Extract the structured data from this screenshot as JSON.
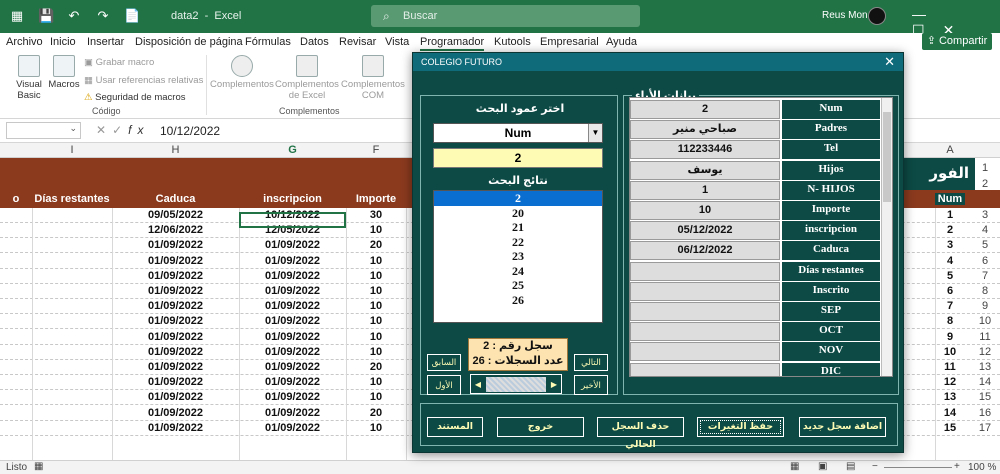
{
  "window": {
    "doc_name": "data2",
    "app_name": "Excel",
    "search_placeholder": "Buscar",
    "user_name": "Reus Mon",
    "controls": [
      "—",
      "☐",
      "✕"
    ]
  },
  "quick_access": [
    "💾",
    "↶",
    "↷",
    "📄"
  ],
  "menu": {
    "tabs": [
      "Archivo",
      "Inicio",
      "Insertar",
      "Disposición de página",
      "Fórmulas",
      "Datos",
      "Revisar",
      "Vista",
      "Programador",
      "Kutools",
      "Empresarial",
      "Ayuda"
    ],
    "active": "Programador",
    "share_label": "Compartir"
  },
  "ribbon": {
    "visual_basic": "Visual Basic",
    "macros": "Macros",
    "grabar_macro": "Grabar macro",
    "usar_referencias": "Usar referencias relativas",
    "seguridad": "Seguridad de macros",
    "codigo_group": "Código",
    "complementos": "Complementos",
    "complementos_excel": "Complementos de Excel",
    "complementos_com": "Complementos COM",
    "complementos_group": "Complementos"
  },
  "formula_bar": {
    "fx": "fx",
    "value": "10/12/2022"
  },
  "sheet": {
    "col_headers": [
      "I",
      "H",
      "G",
      "F",
      "A"
    ],
    "selected_col": "G",
    "table_headers": [
      "o",
      "Días restantes",
      "Caduca",
      "inscripcion",
      "Importe",
      "Num"
    ],
    "right_band_text": "الفور",
    "rows": [
      {
        "caduca": "09/05/2022",
        "inscripcion": "10/12/2022",
        "importe": "30",
        "num": "1",
        "row": "3"
      },
      {
        "caduca": "12/06/2022",
        "inscripcion": "12/05/2022",
        "importe": "10",
        "num": "2",
        "row": "4"
      },
      {
        "caduca": "01/09/2022",
        "inscripcion": "01/09/2022",
        "importe": "20",
        "num": "3",
        "row": "5"
      },
      {
        "caduca": "01/09/2022",
        "inscripcion": "01/09/2022",
        "importe": "10",
        "num": "4",
        "row": "6"
      },
      {
        "caduca": "01/09/2022",
        "inscripcion": "01/09/2022",
        "importe": "10",
        "num": "5",
        "row": "7"
      },
      {
        "caduca": "01/09/2022",
        "inscripcion": "01/09/2022",
        "importe": "10",
        "num": "6",
        "row": "8"
      },
      {
        "caduca": "01/09/2022",
        "inscripcion": "01/09/2022",
        "importe": "10",
        "num": "7",
        "row": "9"
      },
      {
        "caduca": "01/09/2022",
        "inscripcion": "01/09/2022",
        "importe": "10",
        "num": "8",
        "row": "10"
      },
      {
        "caduca": "01/09/2022",
        "inscripcion": "01/09/2022",
        "importe": "10",
        "num": "9",
        "row": "11"
      },
      {
        "caduca": "01/09/2022",
        "inscripcion": "01/09/2022",
        "importe": "10",
        "num": "10",
        "row": "12"
      },
      {
        "caduca": "01/09/2022",
        "inscripcion": "01/09/2022",
        "importe": "20",
        "num": "11",
        "row": "13"
      },
      {
        "caduca": "01/09/2022",
        "inscripcion": "01/09/2022",
        "importe": "10",
        "num": "12",
        "row": "14"
      },
      {
        "caduca": "01/09/2022",
        "inscripcion": "01/09/2022",
        "importe": "10",
        "num": "13",
        "row": "15"
      },
      {
        "caduca": "01/09/2022",
        "inscripcion": "01/09/2022",
        "importe": "20",
        "num": "14",
        "row": "16"
      },
      {
        "caduca": "01/09/2022",
        "inscripcion": "01/09/2022",
        "importe": "10",
        "num": "15",
        "row": "17"
      }
    ],
    "row_header_top": [
      "1",
      "2"
    ]
  },
  "status": {
    "left": "Listo",
    "zoom": "100 %"
  },
  "dialog": {
    "title": "COLEGIO FUTURO",
    "close": "✕",
    "search_col_label": "اختر عمود البحث",
    "combo_value": "Num",
    "search_value": "2",
    "results_label": "نتائج البحث",
    "results": [
      "2",
      "20",
      "21",
      "22",
      "23",
      "24",
      "25",
      "26"
    ],
    "selected_result": "2",
    "record_line1": "سجل رقم : 2",
    "record_line2": "عدد السجلات : 26",
    "btn_prev": "السابق",
    "btn_next": "التالي",
    "btn_first": "الأول",
    "btn_last": "الأخير",
    "data_panel_label": "بيانات الأباء",
    "fields": [
      {
        "label": "Num",
        "value": "2"
      },
      {
        "label": "Padres",
        "value": "صباحي منير"
      },
      {
        "label": "Tel",
        "value": "112233446"
      },
      {
        "label": "Hijos",
        "value": "يوسف"
      },
      {
        "label": "N- HIJOS",
        "value": "1"
      },
      {
        "label": "Importe",
        "value": "10"
      },
      {
        "label": "inscripcion",
        "value": "05/12/2022"
      },
      {
        "label": "Caduca",
        "value": "06/12/2022"
      },
      {
        "label": "Días restantes",
        "value": ""
      },
      {
        "label": "Inscrito",
        "value": ""
      },
      {
        "label": "SEP",
        "value": ""
      },
      {
        "label": "OCT",
        "value": ""
      },
      {
        "label": "NOV",
        "value": ""
      },
      {
        "label": "DIC",
        "value": ""
      }
    ],
    "bottom_buttons": {
      "add": "اضافة سجل جديد",
      "save": "حفظ التغيرات",
      "delete": "حذف السجل الحالي",
      "exit": "خروج",
      "doc": "المستند"
    }
  }
}
